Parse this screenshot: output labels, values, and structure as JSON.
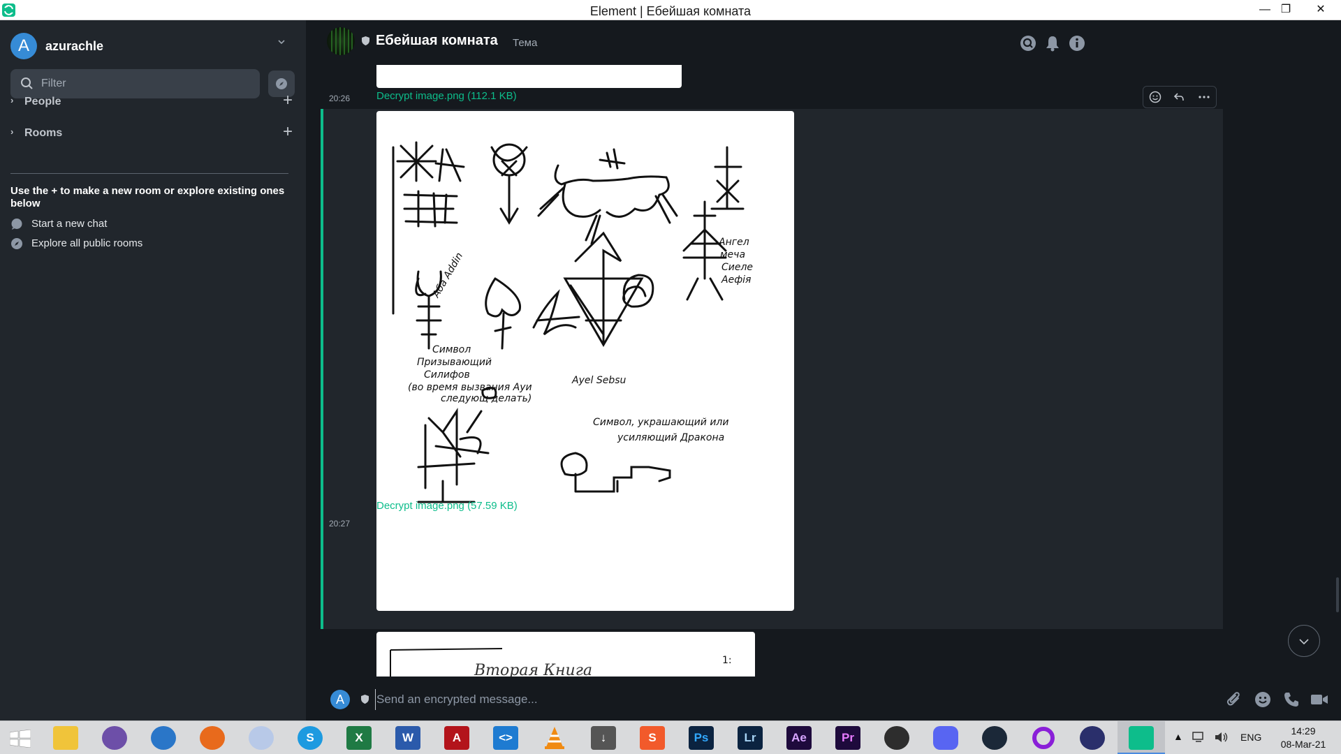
{
  "window": {
    "title": "Element | Ебейшая комната",
    "minimize": "—",
    "restore": "❐",
    "close": "✕"
  },
  "sidebar": {
    "user": {
      "avatar_letter": "A",
      "name": "azurachle"
    },
    "filter_placeholder": "Filter",
    "sections": [
      {
        "label": "People"
      },
      {
        "label": "Rooms"
      }
    ],
    "hint": "Use the + to make a new room or explore existing ones below",
    "links": [
      {
        "label": "Start a new chat",
        "icon": "chat-bubble-icon"
      },
      {
        "label": "Explore all public rooms",
        "icon": "compass-icon"
      }
    ]
  },
  "room": {
    "name": "Ебейшая комната",
    "topic": "Тема"
  },
  "timeline": {
    "file_top": "Decrypt image.png (112.1 KB)",
    "message": {
      "time": "20:26",
      "file_label": "Decrypt image.png (57.59 KB)"
    },
    "next_message": {
      "time": "20:27"
    },
    "image_texts": {
      "angel": "Ангел\nмеча\nСиеле\nАефiя",
      "aba": "Аба Addin",
      "summon": "Символ\nПризывающий\nСилифов\n(во время вызвания Ауи\nследующ делать)",
      "ayel": "Ayel  Sebsu",
      "dragon": "Символ, украшающий или\nусиляющий Дракона",
      "next_page": "Вторая   Книга",
      "next_page_num": "1:"
    }
  },
  "composer": {
    "avatar_letter": "A",
    "placeholder": "Send an encrypted message..."
  },
  "taskbar": {
    "apps": [
      {
        "name": "windows-start"
      },
      {
        "name": "file-explorer"
      },
      {
        "name": "bittorrent"
      },
      {
        "name": "browser"
      },
      {
        "name": "firefox"
      },
      {
        "name": "moon-app"
      },
      {
        "name": "skype",
        "label": "S"
      },
      {
        "name": "excel",
        "label": "X"
      },
      {
        "name": "word",
        "label": "W"
      },
      {
        "name": "acrobat",
        "label": "A"
      },
      {
        "name": "vscode",
        "label": "<>"
      },
      {
        "name": "vlc"
      },
      {
        "name": "downloader"
      },
      {
        "name": "sublime",
        "label": "S"
      },
      {
        "name": "photoshop",
        "label": "Ps"
      },
      {
        "name": "lightroom",
        "label": "Lr"
      },
      {
        "name": "after-effects",
        "label": "Ae"
      },
      {
        "name": "premiere",
        "label": "Pr"
      },
      {
        "name": "obs"
      },
      {
        "name": "discord"
      },
      {
        "name": "steam"
      },
      {
        "name": "ring-app"
      },
      {
        "name": "vpn-lock"
      },
      {
        "name": "element"
      }
    ],
    "tray_arrow": "▲",
    "language": "ENG",
    "time": "14:29",
    "date": "08-Mar-21"
  }
}
